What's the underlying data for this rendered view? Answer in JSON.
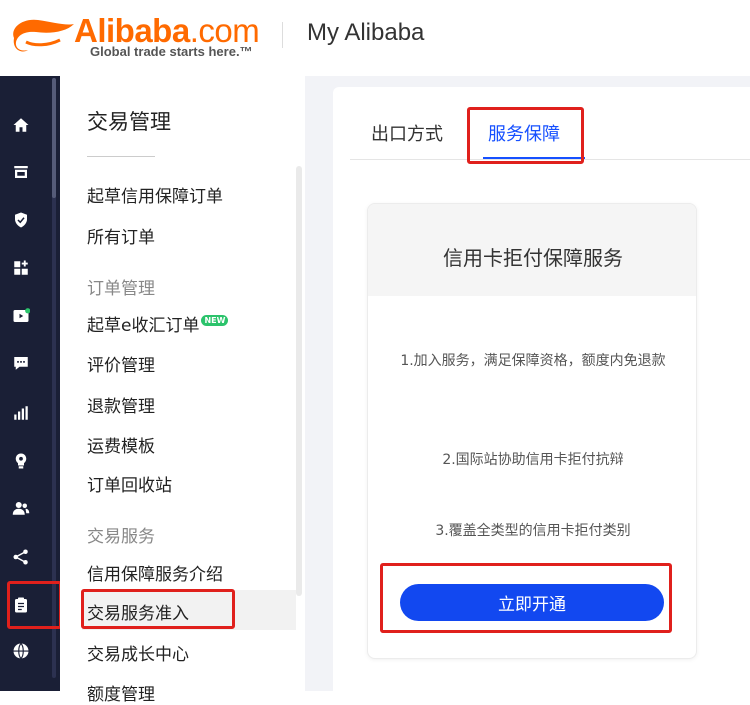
{
  "header": {
    "logo_text": "Alibaba",
    "logo_com": ".com",
    "logo_tagline": "Global trade starts here.™",
    "title": "My Alibaba"
  },
  "rail": {
    "icons": [
      "home-icon",
      "store-icon",
      "shield-icon",
      "grid-plus-icon",
      "video-icon",
      "message-icon",
      "bar-chart-icon",
      "lightbulb-icon",
      "users-icon",
      "share-icon",
      "clipboard-icon",
      "globe-icon"
    ],
    "active": "clipboard-icon"
  },
  "menu": {
    "title": "交易管理",
    "items_top": [
      "起草信用保障订单",
      "所有订单"
    ],
    "group_order": "订单管理",
    "items_order": [
      "起草e收汇订单",
      "评价管理",
      "退款管理",
      "运费模板",
      "订单回收站"
    ],
    "new_badge": "NEW",
    "group_service": "交易服务",
    "items_service": [
      "信用保障服务介绍",
      "交易服务准入",
      "交易成长中心",
      "额度管理"
    ],
    "active_item": "交易服务准入"
  },
  "tabs": {
    "export_label": "出口方式",
    "service_label": "服务保障",
    "active": "服务保障"
  },
  "card": {
    "title": "信用卡拒付保障服务",
    "point1": "1.加入服务，满足保障资格，额度内免退款",
    "point2": "2.国际站协助信用卡拒付抗辩",
    "point3": "3.覆盖全类型的信用卡拒付类别",
    "button_label": "立即开通"
  },
  "colors": {
    "brand": "#ff6a00",
    "rail_bg": "#1a1f36",
    "accent": "#1650ff",
    "button": "#1248f0",
    "highlight": "#e0201c",
    "badge": "#2bc36b"
  }
}
